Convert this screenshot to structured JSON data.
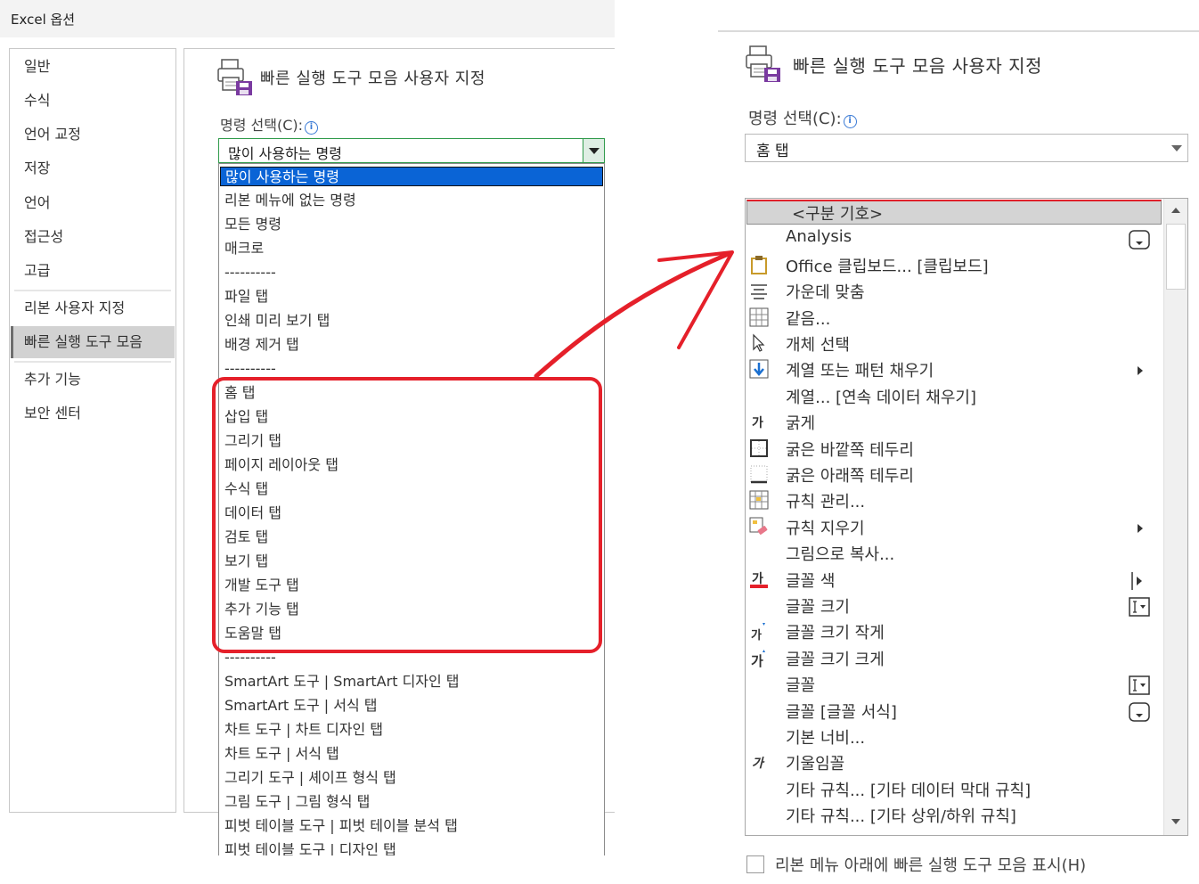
{
  "left_dialog": {
    "title": "Excel 옵션",
    "nav": {
      "items": [
        "일반",
        "수식",
        "언어 교정",
        "저장",
        "언어",
        "접근성",
        "고급",
        "리본 사용자 지정",
        "빠른 실행 도구 모음",
        "추가 기능",
        "보안 센터"
      ],
      "selected": "빠른 실행 도구 모음"
    },
    "heading": "빠른 실행 도구 모음 사용자 지정",
    "choose_label": "명령 선택(C):",
    "combo_value": "많이 사용하는 명령",
    "dropdown_items": [
      "많이 사용하는 명령",
      "리본 메뉴에 없는 명령",
      "모든 명령",
      "매크로",
      "----------",
      "파일 탭",
      "인쇄 미리 보기 탭",
      "배경 제거 탭",
      "----------",
      "홈 탭",
      "삽입 탭",
      "그리기 탭",
      "페이지 레이아웃 탭",
      "수식 탭",
      "데이터 탭",
      "검토 탭",
      "보기 탭",
      "개발 도구 탭",
      "추가 기능 탭",
      "도움말 탭",
      "----------",
      "SmartArt 도구 | SmartArt 디자인 탭",
      "SmartArt 도구 | 서식 탭",
      "차트 도구 | 차트 디자인 탭",
      "차트 도구 | 서식 탭",
      "그리기 도구 | 셰이프 형식 탭",
      "그림 도구 | 그림 형식 탭",
      "피벗 테이블 도구 | 피벗 테이블 분석 탭",
      "피벗 테이블 도구 | 디자인 탭"
    ]
  },
  "right_panel": {
    "heading": "빠른 실행 도구 모음 사용자 지정",
    "choose_label": "명령 선택(C):",
    "combo_value": "홈 탭",
    "commands": [
      {
        "label": "<구분 기호>",
        "icon": "none",
        "right": "none"
      },
      {
        "label": "Analysis",
        "icon": "none",
        "right": "dropdown-box-icon"
      },
      {
        "label": "Office 클립보드... [클립보드]",
        "icon": "clipboard-icon",
        "right": "none"
      },
      {
        "label": "가운데 맞춤",
        "icon": "align-center-icon",
        "right": "none"
      },
      {
        "label": "같음...",
        "icon": "table-grid-icon",
        "right": "none"
      },
      {
        "label": "개체 선택",
        "icon": "pointer-arrow-icon",
        "right": "none"
      },
      {
        "label": "계열 또는 패턴 채우기",
        "icon": "fill-down-icon",
        "right": "submenu-arrow-icon"
      },
      {
        "label": "계열... [연속 데이터 채우기]",
        "icon": "none",
        "right": "none"
      },
      {
        "label": "굵게",
        "icon": "bold-icon",
        "right": "none"
      },
      {
        "label": "굵은 바깥쪽 테두리",
        "icon": "thick-box-border-icon",
        "right": "none"
      },
      {
        "label": "굵은 아래쪽 테두리",
        "icon": "thick-bottom-border-icon",
        "right": "none"
      },
      {
        "label": "규칙 관리...",
        "icon": "manage-rules-icon",
        "right": "none"
      },
      {
        "label": "규칙 지우기",
        "icon": "clear-rules-icon",
        "right": "submenu-arrow-icon"
      },
      {
        "label": "그림으로 복사...",
        "icon": "none",
        "right": "none"
      },
      {
        "label": "글꼴 색",
        "icon": "font-color-icon",
        "right": "split-arrow-icon"
      },
      {
        "label": "글꼴 크기",
        "icon": "none",
        "right": "text-input-icon"
      },
      {
        "label": "글꼴 크기 작게",
        "icon": "decrease-font-icon",
        "right": "none"
      },
      {
        "label": "글꼴 크기 크게",
        "icon": "increase-font-icon",
        "right": "none"
      },
      {
        "label": "글꼴",
        "icon": "none",
        "right": "text-input-icon"
      },
      {
        "label": "글꼴 [글꼴 서식]",
        "icon": "none",
        "right": "dropdown-box-icon"
      },
      {
        "label": "기본 너비...",
        "icon": "none",
        "right": "none"
      },
      {
        "label": "기울임꼴",
        "icon": "italic-icon",
        "right": "none"
      },
      {
        "label": "기타 규칙... [기타 데이터 막대 규칙]",
        "icon": "none",
        "right": "none"
      },
      {
        "label": "기타 규칙... [기타 상위/하위 규칙]",
        "icon": "none",
        "right": "none"
      }
    ],
    "show_below_label": "리본 메뉴 아래에 빠른 실행 도구 모음 표시(H)",
    "show_below_checked": false
  },
  "colors": {
    "highlight_red": "#e5202a",
    "selection_blue": "#0a64d6",
    "combo_green": "#2f9a4a"
  }
}
